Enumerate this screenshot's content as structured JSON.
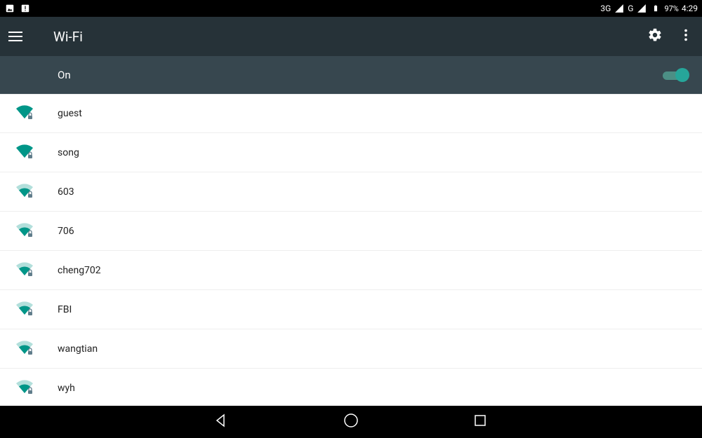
{
  "status": {
    "network_label": "3G",
    "network_label2": "G",
    "battery_pct": "97%",
    "time": "4:29"
  },
  "appbar": {
    "title": "Wi-Fi"
  },
  "toggle": {
    "label": "On",
    "enabled": true
  },
  "networks": [
    {
      "ssid": "guest",
      "strength": "full",
      "secured": true
    },
    {
      "ssid": "song",
      "strength": "full",
      "secured": true
    },
    {
      "ssid": "603",
      "strength": "medium",
      "secured": true
    },
    {
      "ssid": "706",
      "strength": "medium",
      "secured": true
    },
    {
      "ssid": "cheng702",
      "strength": "medium",
      "secured": true
    },
    {
      "ssid": "FBI",
      "strength": "medium",
      "secured": true
    },
    {
      "ssid": "wangtian",
      "strength": "medium",
      "secured": true
    },
    {
      "ssid": "wyh",
      "strength": "medium",
      "secured": true
    }
  ]
}
